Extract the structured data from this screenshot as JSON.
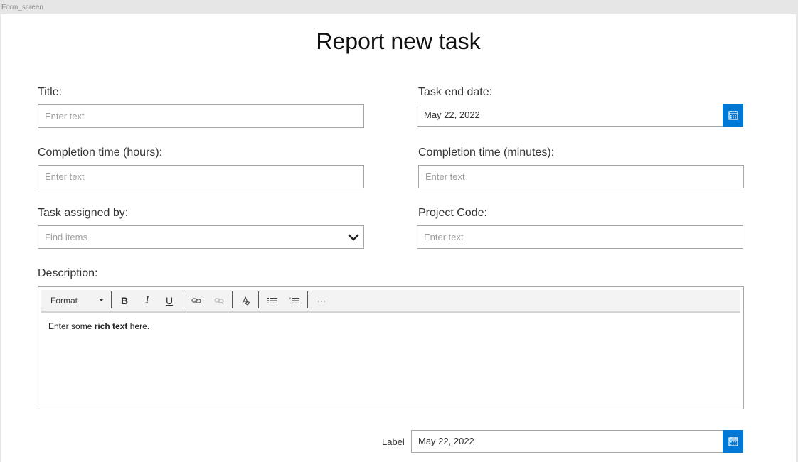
{
  "screen_name": "Form_screen",
  "page_title": "Report new task",
  "fields": {
    "title": {
      "label": "Title:",
      "placeholder": "Enter text"
    },
    "task_end_date": {
      "label": "Task end date:",
      "value": "May 22, 2022"
    },
    "completion_hours": {
      "label": "Completion time (hours):",
      "placeholder": "Enter text"
    },
    "completion_minutes": {
      "label": "Completion time (minutes):",
      "placeholder": "Enter text"
    },
    "task_assigned_by": {
      "label": "Task assigned by:",
      "placeholder": "Find items"
    },
    "project_code": {
      "label": "Project Code:",
      "placeholder": "Enter text"
    },
    "description": {
      "label": "Description:",
      "toolbar": {
        "format_label": "Format",
        "bold": "B",
        "italic": "I",
        "underline": "U",
        "more": "···",
        "icons": [
          "link-icon",
          "unlink-icon",
          "clear-format-icon",
          "bulleted-list-icon",
          "numbered-list-icon"
        ]
      },
      "body_prefix": "Enter some ",
      "body_bold": "rich text",
      "body_suffix": " here."
    }
  },
  "footer": {
    "label": "Label",
    "date_value": "May 22, 2022"
  },
  "colors": {
    "accent": "#0078d4",
    "border": "#a6a6a6",
    "placeholder": "#a19f9d"
  }
}
